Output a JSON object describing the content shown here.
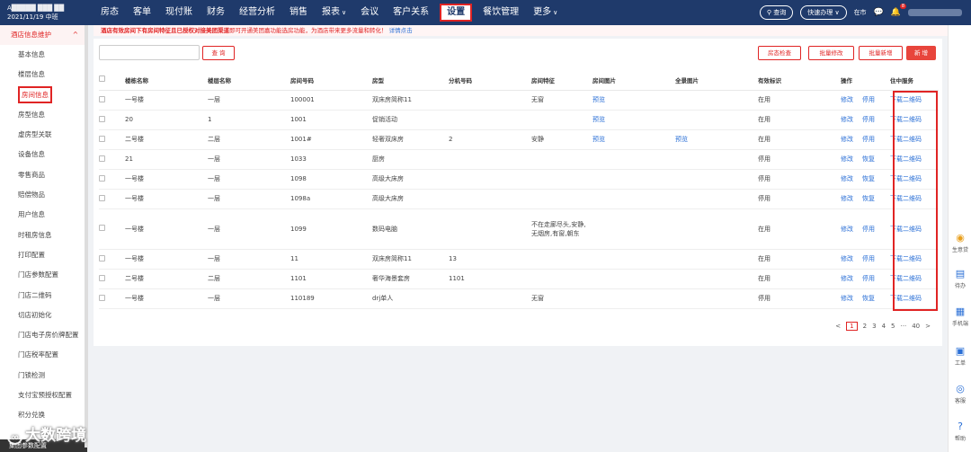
{
  "brand": {
    "line1": "A█████ ███ ██",
    "line2": "2021/11/19 中班"
  },
  "nav": {
    "items": [
      "房态",
      "客单",
      "现付账",
      "财务",
      "经营分析",
      "销售",
      "报表",
      "会议",
      "客户关系",
      "设置",
      "餐饮管理",
      "更多"
    ],
    "active": "设置"
  },
  "topright": {
    "query": "查询",
    "quick": "快速办理",
    "online": "在市",
    "badge": "8",
    "user": "████████"
  },
  "sidebar": {
    "header": "酒店信息维护",
    "items": [
      "基本信息",
      "楼层信息",
      "房间信息",
      "房型信息",
      "虚房型关联",
      "设备信息",
      "零售商品",
      "赔偿物品",
      "用户信息",
      "时租房信息",
      "打印配置",
      "门店参数配置",
      "门店二维码",
      "切店初始化",
      "门店电子房价牌配置",
      "门店税率配置",
      "门锁检测",
      "支付宝预授权配置",
      "积分兑换"
    ],
    "active_index": 2,
    "footer": "集团参数配置"
  },
  "notice": {
    "part1": "酒店有效房间下有房间特征且已授权对接美团渠道",
    "part2": "即可开通美团嘉功能选房功能，为酒店带来更多流量和转化！",
    "link": "详情点击"
  },
  "toolbar": {
    "query": "查 询",
    "check": "房态检查",
    "batch_edit": "批量修改",
    "batch_add": "批量新增",
    "add": "新 增"
  },
  "table": {
    "headers": [
      "楼栋名称",
      "楼层名称",
      "房间号码",
      "房型",
      "分机号码",
      "房间特征",
      "房间图片",
      "全景图片",
      "有效标识",
      "操作",
      "住中服务"
    ],
    "rows": [
      {
        "building": "一号楼",
        "floor": "一层",
        "room": "100001",
        "type": "双床房简称11",
        "ext": "",
        "feature": "无窗",
        "img": "预览",
        "pano": "",
        "status": "在用",
        "op1": "修改",
        "op2": "停用",
        "svc": "下载二维码"
      },
      {
        "building": "20",
        "floor": "1",
        "room": "1001",
        "type": "促销活动",
        "ext": "",
        "feature": "",
        "img": "预览",
        "pano": "",
        "status": "在用",
        "op1": "修改",
        "op2": "停用",
        "svc": "下载二维码"
      },
      {
        "building": "二号楼",
        "floor": "二层",
        "room": "1001#",
        "type": "轻奢双床房",
        "ext": "2",
        "feature": "安静",
        "img": "预览",
        "pano": "预览",
        "status": "在用",
        "op1": "修改",
        "op2": "停用",
        "svc": "下载二维码"
      },
      {
        "building": "21",
        "floor": "一层",
        "room": "1033",
        "type": "厨房",
        "ext": "",
        "feature": "",
        "img": "",
        "pano": "",
        "status": "停用",
        "op1": "修改",
        "op2": "恢复",
        "svc": "下载二维码"
      },
      {
        "building": "一号楼",
        "floor": "一层",
        "room": "1098",
        "type": "高级大床房",
        "ext": "",
        "feature": "",
        "img": "",
        "pano": "",
        "status": "停用",
        "op1": "修改",
        "op2": "恢复",
        "svc": "下载二维码"
      },
      {
        "building": "一号楼",
        "floor": "一层",
        "room": "1098a",
        "type": "高级大床房",
        "ext": "",
        "feature": "",
        "img": "",
        "pano": "",
        "status": "停用",
        "op1": "修改",
        "op2": "恢复",
        "svc": "下载二维码"
      },
      {
        "building": "一号楼",
        "floor": "一层",
        "room": "1099",
        "type": "数码电脑",
        "ext": "",
        "feature": "不在走廊尽头,安静,无烟房,有窗,朝东",
        "img": "",
        "pano": "",
        "status": "在用",
        "op1": "修改",
        "op2": "停用",
        "svc": "下载二维码"
      },
      {
        "building": "一号楼",
        "floor": "一层",
        "room": "11",
        "type": "双床房简称11",
        "ext": "13",
        "feature": "",
        "img": "",
        "pano": "",
        "status": "在用",
        "op1": "修改",
        "op2": "停用",
        "svc": "下载二维码"
      },
      {
        "building": "二号楼",
        "floor": "二层",
        "room": "1101",
        "type": "奢华海景套房",
        "ext": "1101",
        "feature": "",
        "img": "",
        "pano": "",
        "status": "在用",
        "op1": "修改",
        "op2": "停用",
        "svc": "下载二维码"
      },
      {
        "building": "一号楼",
        "floor": "一层",
        "room": "110189",
        "type": "drj单人",
        "ext": "",
        "feature": "无窗",
        "img": "",
        "pano": "",
        "status": "停用",
        "op1": "修改",
        "op2": "恢复",
        "svc": "下载二维码"
      }
    ]
  },
  "pager": {
    "prev": "<",
    "pages": [
      "1",
      "2",
      "3",
      "4",
      "5"
    ],
    "ellipsis": "···",
    "last": "40",
    "next": ">"
  },
  "rightbar": [
    "生意贷",
    "待办",
    "手机端",
    "工单",
    "客服",
    "帮助"
  ],
  "watermark": "大数跨境",
  "colors": {
    "nav_bg": "#1f3a6b",
    "accent": "#e02424",
    "link": "#2a6fd6"
  }
}
